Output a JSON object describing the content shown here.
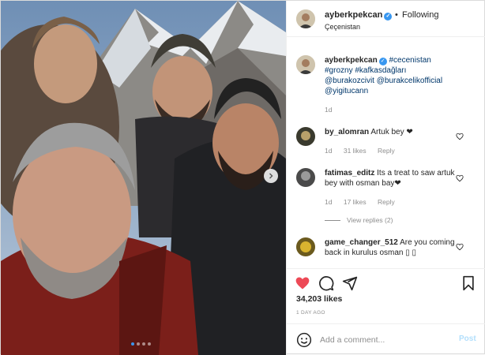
{
  "header": {
    "username": "ayberkpekcan",
    "separator": "•",
    "follow_label": "Following",
    "location": "Çeçenistan"
  },
  "caption": {
    "username": "ayberkpekcan",
    "text_parts": [
      "#cecenistan",
      "#grozny",
      "#kafkasdağları",
      "@burakozcivit",
      "@burakcelikofficial",
      "@yigitucann"
    ],
    "time": "1d"
  },
  "comments": [
    {
      "username": "by_alomran",
      "text": "Artuk bey ❤",
      "time": "1d",
      "likes": "31 likes",
      "reply": "Reply"
    },
    {
      "username": "fatimas_editz",
      "text": "Its a treat to saw artuk bey with osman bay❤",
      "time": "1d",
      "likes": "17 likes",
      "reply": "Reply",
      "view_replies": "View replies (2)"
    },
    {
      "username": "game_changer_512",
      "text": "Are you coming back in kurulus osman ▯ ▯",
      "time": "",
      "likes": "",
      "reply": ""
    }
  ],
  "actions": {
    "likes": "34,203 likes",
    "time_ago": "1 DAY AGO"
  },
  "add_comment": {
    "placeholder": "Add a comment...",
    "post_label": "Post"
  },
  "colors": {
    "liked_heart": "#ed4956",
    "link": "#00376b",
    "verified": "#3897f0"
  },
  "icons": [
    "heart-icon",
    "comment-icon",
    "share-icon",
    "bookmark-icon",
    "smile-icon",
    "verified-icon",
    "chevron-right-icon"
  ]
}
